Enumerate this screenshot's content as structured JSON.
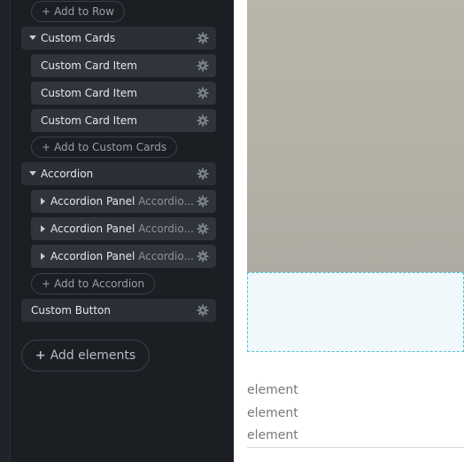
{
  "panel": {
    "add_to_row": {
      "plus": "+",
      "label": "Add to Row"
    },
    "custom_cards": {
      "label": "Custom Cards",
      "items": [
        {
          "label": "Custom Card Item"
        },
        {
          "label": "Custom Card Item"
        },
        {
          "label": "Custom Card Item"
        }
      ],
      "add_label": "Add to Custom Cards"
    },
    "accordion": {
      "label": "Accordion",
      "items": [
        {
          "label": "Accordion Panel",
          "sub": "Accordio..."
        },
        {
          "label": "Accordion Panel",
          "sub": "Accordio..."
        },
        {
          "label": "Accordion Panel",
          "sub": "Accordio..."
        }
      ],
      "add_label": "Add to Accordion"
    },
    "custom_button": {
      "label": "Custom Button"
    },
    "add_elements": {
      "plus": "+",
      "label": "Add elements"
    },
    "icon": "gear-icon"
  },
  "preview": {
    "elements": [
      "element",
      "element",
      "element"
    ]
  }
}
